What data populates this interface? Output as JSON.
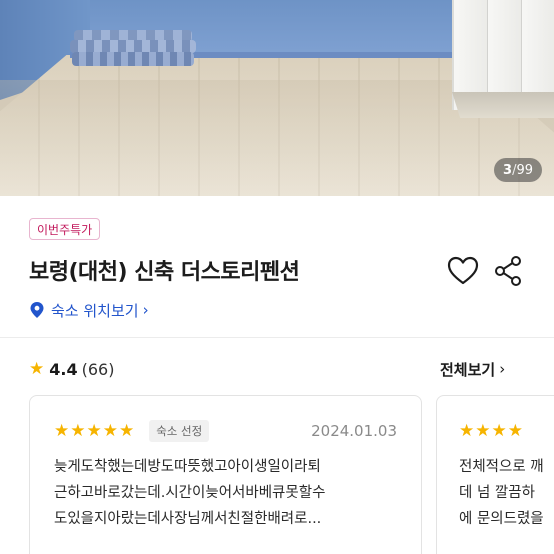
{
  "gallery": {
    "current": "3",
    "separator": "/",
    "total": "99"
  },
  "badge": "이번주특가",
  "title": "보령(대천) 신축 더스토리펜션",
  "location": {
    "label": "숙소 위치보기",
    "chevron": "›"
  },
  "rating": {
    "star": "★",
    "score": "4.4",
    "count": "(66)"
  },
  "see_all": {
    "label": "전체보기",
    "chevron": "›"
  },
  "reviews": [
    {
      "stars": "★★★★★",
      "pick_label": "숙소 선정",
      "date": "2024.01.03",
      "lines": [
        "늦게도착했는데방도따뜻했고아이생일이라퇴",
        "근하고바로갔는데.시간이늦어서바베큐못할수",
        "도있을지아랐는데사장님께서친절한배려로..."
      ]
    },
    {
      "stars": "★★★★",
      "lines": [
        "전체적으로 깨",
        "데 넘 깔끔하",
        "에 문의드렸을"
      ]
    }
  ],
  "colors": {
    "accent_blue": "#2255cc",
    "badge_pink": "#c2185b",
    "star_yellow": "#f6b400"
  },
  "icons": {
    "heart": "heart-icon",
    "share": "share-icon",
    "pin": "location-pin-icon"
  }
}
